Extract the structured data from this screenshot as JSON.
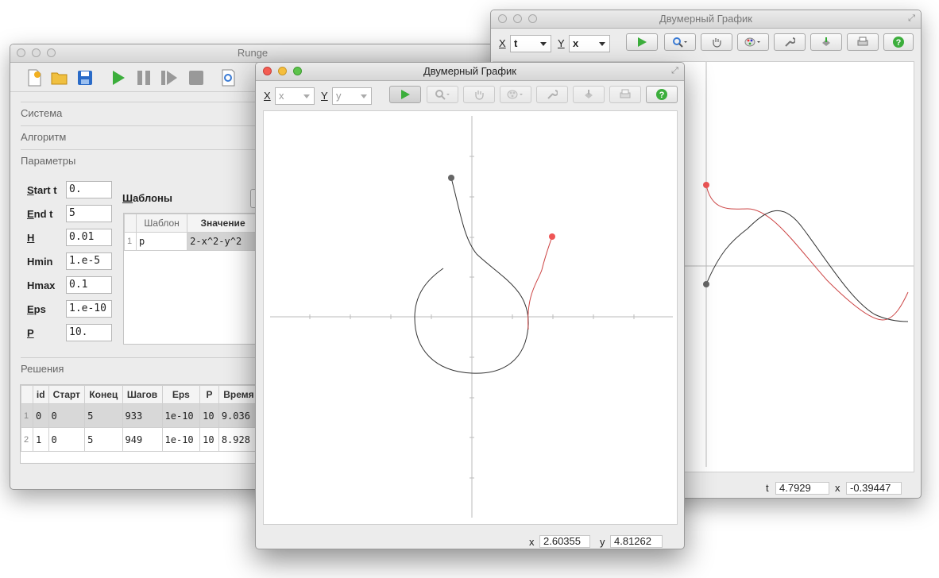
{
  "runge": {
    "title": "Runge",
    "sections": {
      "system": "Система",
      "algorithm": "Алгоритм",
      "params": "Параметры",
      "solutions": "Решения"
    },
    "params": [
      {
        "key": "S",
        "rest": "tart t",
        "value": "0."
      },
      {
        "key": "E",
        "rest": "nd t",
        "value": "5"
      },
      {
        "key": "H",
        "rest": "",
        "value": "0.01"
      },
      {
        "key": "Hmin",
        "rest": "",
        "value": "1.e-5"
      },
      {
        "key": "Hmax",
        "rest": "",
        "value": "0.1"
      },
      {
        "key": "E",
        "rest": "ps",
        "value": "1.e-10"
      },
      {
        "key": "P",
        "rest": "",
        "value": "10."
      }
    ],
    "templates": {
      "label_first": "Ш",
      "label_rest": "аблоны",
      "columns": [
        "Шаблон",
        "Значение"
      ],
      "rows": [
        {
          "n": "1",
          "name": "p",
          "value": "2-x^2-y^2"
        }
      ]
    },
    "solutions": {
      "columns": [
        "id",
        "Старт",
        "Конец",
        "Шагов",
        "Eps",
        "P",
        "Время"
      ],
      "rows": [
        {
          "n": "1",
          "id": "0",
          "start": "0",
          "end": "5",
          "steps": "933",
          "eps": "1e-10",
          "p": "10",
          "time": "9.036"
        },
        {
          "n": "2",
          "id": "1",
          "start": "0",
          "end": "5",
          "steps": "949",
          "eps": "1e-10",
          "p": "10",
          "time": "8.928"
        }
      ]
    }
  },
  "plot_back": {
    "title": "Двумерный График",
    "x_label": "X",
    "x_value": "t",
    "y_label": "Y",
    "y_value": "x",
    "status": {
      "t_label": "t",
      "t_value": "4.7929",
      "x_label": "x",
      "x_value": "-0.39447"
    }
  },
  "plot_front": {
    "title": "Двумерный График",
    "x_label": "X",
    "x_value": "x",
    "y_label": "Y",
    "y_value": "y",
    "status": {
      "x_label": "x",
      "x_value": "2.60355",
      "y_label": "y",
      "y_value": "4.81262"
    }
  },
  "colors": {
    "curve_dark": "#333333",
    "curve_red": "#cc4444",
    "point_gray": "#666666",
    "point_red": "#ee5555"
  }
}
